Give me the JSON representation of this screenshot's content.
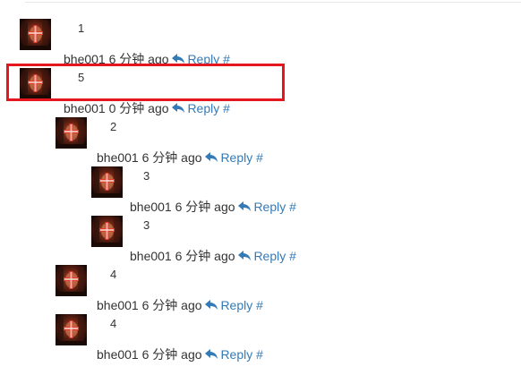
{
  "comments": [
    {
      "id": "c1",
      "depth": 0,
      "body": "1",
      "author": "bhe001",
      "time": "6 分钟 ago",
      "reply_label": "Reply",
      "permalink": "#"
    },
    {
      "id": "c2",
      "depth": 0,
      "body": "5",
      "author": "bhe001",
      "time": "0 分钟 ago",
      "reply_label": "Reply",
      "permalink": "#",
      "highlighted": true
    },
    {
      "id": "c3",
      "depth": 1,
      "body": "2",
      "author": "bhe001",
      "time": "6 分钟 ago",
      "reply_label": "Reply",
      "permalink": "#"
    },
    {
      "id": "c4",
      "depth": 2,
      "body": "3",
      "author": "bhe001",
      "time": "6 分钟 ago",
      "reply_label": "Reply",
      "permalink": "#"
    },
    {
      "id": "c5",
      "depth": 2,
      "body": "3",
      "author": "bhe001",
      "time": "6 分钟 ago",
      "reply_label": "Reply",
      "permalink": "#"
    },
    {
      "id": "c6",
      "depth": 1,
      "body": "4",
      "author": "bhe001",
      "time": "6 分钟 ago",
      "reply_label": "Reply",
      "permalink": "#"
    },
    {
      "id": "c7",
      "depth": 1,
      "body": "4",
      "author": "bhe001",
      "time": "6 分钟 ago",
      "reply_label": "Reply",
      "permalink": "#"
    }
  ],
  "icons": {
    "avatar": "avatar-icon",
    "reply": "reply-icon"
  },
  "colors": {
    "link": "#337ab7",
    "highlight_border": "#e4161e",
    "text": "#333333"
  }
}
